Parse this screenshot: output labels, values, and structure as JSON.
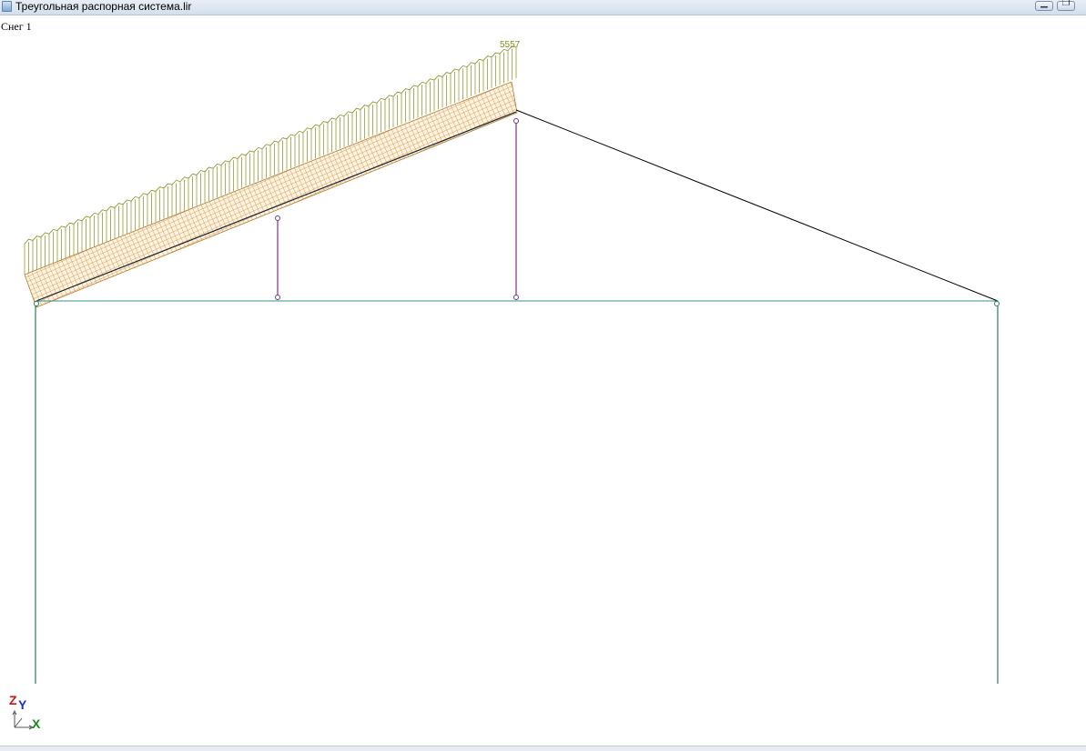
{
  "window": {
    "title": "Треугольная распорная система.lir",
    "minimize_glyph": "▁",
    "restore_glyph": "❐"
  },
  "load_case": {
    "label": "Снег 1"
  },
  "colors": {
    "slope_beam": "#000000",
    "tie": "#3a8f8f",
    "column": "#2f7c5e",
    "hanger": "#8a2a8a",
    "load_arrows": "#8a8a1a",
    "load_fill": "#c8893a",
    "node": "#6a3a7a"
  },
  "axes": {
    "z": "Z",
    "y": "Y",
    "x": "X",
    "z_color": "#d01010",
    "y_color": "#1a2fd0",
    "x_color": "#1a8a1a"
  },
  "load_value_label": "5557"
}
